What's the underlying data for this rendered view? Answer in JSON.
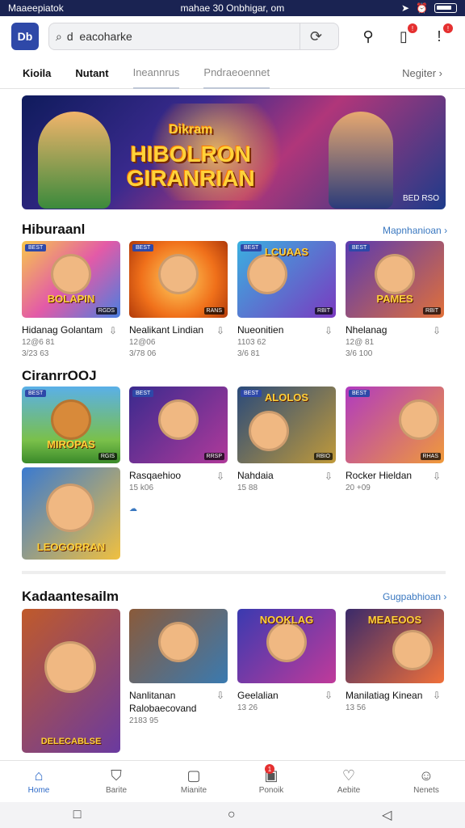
{
  "status": {
    "left": "Maaeepiatok",
    "center": "mahae 30 Onbhigar, om"
  },
  "header": {
    "logo": "Db",
    "search_value": "d  eacoharke",
    "search_icon": "search-icon"
  },
  "tabs": [
    {
      "label": "Kioila",
      "active": true
    },
    {
      "label": "Nutant",
      "active": true
    },
    {
      "label": "Ineannrus",
      "active": false
    },
    {
      "label": "Pndraeoennet",
      "active": false
    }
  ],
  "tabs_more": "Negiter",
  "hero": {
    "title_small": "Dikram",
    "title_line1": "HIBOLRON",
    "title_line2": "GIRANRIAN",
    "caption": "BED RSO"
  },
  "section1": {
    "title": "Hiburaanl",
    "link": "Mapnhanioan",
    "items": [
      {
        "name": "Hidanag Golantam",
        "meta1": "12@6 81",
        "meta2": "3/23 63",
        "tag": "BEST",
        "corner": "RGDS",
        "label": "BOLAPIN"
      },
      {
        "name": "Nealikant Lindian",
        "meta1": "12@06",
        "meta2": "3/78 06",
        "tag": "BEST",
        "corner": "RANS",
        "label": ""
      },
      {
        "name": "Nueonitien",
        "meta1": "1103 62",
        "meta2": "3/6 81",
        "tag": "BEST",
        "corner": "RBIT",
        "label": "LCUAAS"
      },
      {
        "name": "Nhelanag",
        "meta1": "12@ 81",
        "meta2": "3/6 100",
        "tag": "BEST",
        "corner": "RBIT",
        "label": "PAMES"
      }
    ]
  },
  "section2": {
    "title": "CiranrrOOJ",
    "items": [
      {
        "name": "",
        "meta1": "",
        "tag": "BEST",
        "corner": "RGIS",
        "label": "MIROPAS"
      },
      {
        "name": "Rasqaehioo",
        "meta1": "15 k06",
        "tag": "BEST",
        "corner": "RRSP",
        "label": ""
      },
      {
        "name": "Nahdaia",
        "meta1": "15 88",
        "tag": "BEST",
        "corner": "RBIO",
        "label": "ALOLOS"
      },
      {
        "name": "Rocker Hieldan",
        "meta1": "20 +09",
        "tag": "BEST",
        "corner": "RHAS",
        "label": ""
      }
    ],
    "extra": {
      "label": "LEOGORRAN"
    }
  },
  "section3": {
    "title": "Kadaantesailm",
    "link": "Gugpabhioan",
    "items": [
      {
        "name": "",
        "meta1": "",
        "label": "DELECABLSE"
      },
      {
        "name": "Nanlitanan",
        "name2": "Ralobaecovand",
        "meta1": "2183 95",
        "label": ""
      },
      {
        "name": "Geelalian",
        "meta1": "13 26",
        "label": "NOOKLAG"
      },
      {
        "name": "Manilatiag Kinean",
        "meta1": "13 56",
        "label": "MEAEOOS"
      }
    ]
  },
  "bottom_nav": [
    {
      "label": "Home",
      "icon": "home-icon",
      "active": true
    },
    {
      "label": "Barite",
      "icon": "shield-icon",
      "active": false
    },
    {
      "label": "Mianite",
      "icon": "chat-icon",
      "active": false
    },
    {
      "label": "Ponoik",
      "icon": "calendar-icon",
      "active": false,
      "badge": "1"
    },
    {
      "label": "Aebite",
      "icon": "heart-icon",
      "active": false
    },
    {
      "label": "Nenets",
      "icon": "user-icon",
      "active": false
    }
  ]
}
